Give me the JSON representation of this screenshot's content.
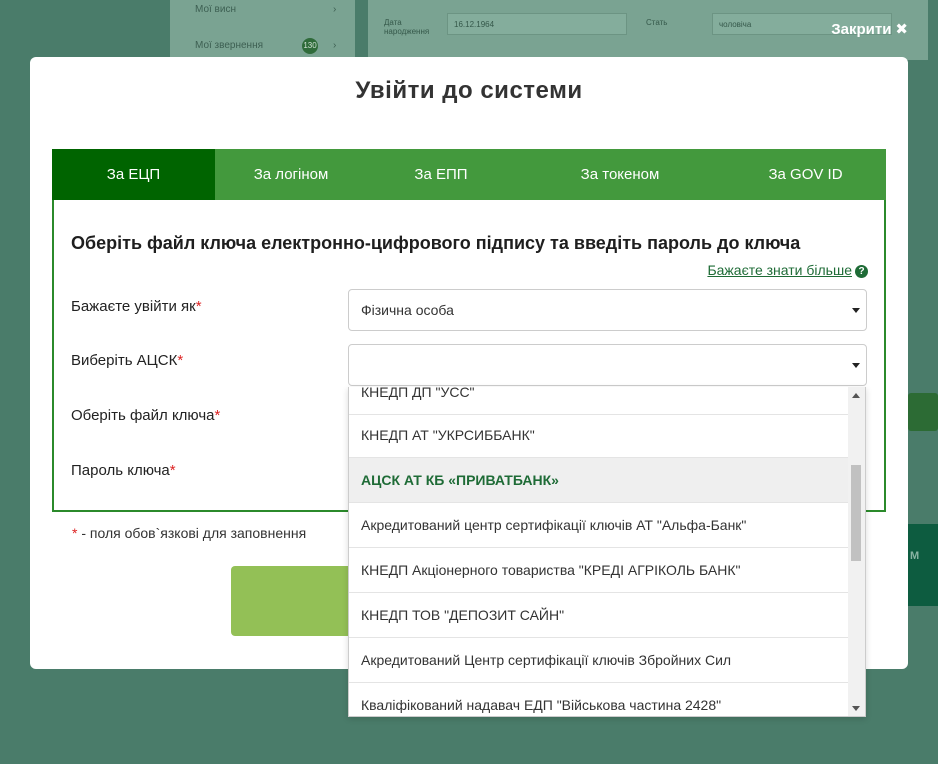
{
  "background": {
    "sidebar_items": [
      {
        "label": "Мої висн"
      },
      {
        "label": "Мої звернення",
        "badge": "130"
      }
    ],
    "form": {
      "dob_label": "Дата народження",
      "dob_value": "16.12.1964",
      "sex_label": "Стать",
      "sex_value": "чоловіча"
    },
    "side_block_label": "М"
  },
  "close": {
    "label": "Закрити"
  },
  "modal": {
    "title": "Увійти до системи",
    "tabs": [
      {
        "label": "За ЕЦП",
        "active": true
      },
      {
        "label": "За логіном"
      },
      {
        "label": "За ЕПП"
      },
      {
        "label": "За токеном"
      },
      {
        "label": "За GOV ID"
      }
    ],
    "heading": "Оберіть файл ключа електронно-цифрового підпису та введіть пароль до ключа",
    "more_link": "Бажаєте знати більше",
    "fields": {
      "login_as": {
        "label": "Бажаєте увійти як",
        "value": "Фізична особа"
      },
      "acsk": {
        "label": "Виберіть АЦСК",
        "value": ""
      },
      "key_file": {
        "label": "Оберіть файл ключа"
      },
      "key_password": {
        "label": "Пароль ключа"
      }
    },
    "required_marker": "*",
    "required_note": "- поля обов`язкові для заповнення"
  },
  "acsk_options": [
    {
      "label": "КНЕДП ДП \"УСС\""
    },
    {
      "label": "КНЕДП АТ \"УКРСИББАНК\""
    },
    {
      "label": "АЦСК АТ КБ «ПРИВАТБАНК»",
      "selected": true
    },
    {
      "label": "Акредитований центр сертифікації ключів АТ \"Альфа-Банк\""
    },
    {
      "label": "КНЕДП Акціонерного товариства \"КРЕДІ АГРІКОЛЬ БАНК\""
    },
    {
      "label": "КНЕДП ТОВ \"ДЕПОЗИТ САЙН\""
    },
    {
      "label": "Акредитований Центр сертифікації ключів Збройних Сил"
    },
    {
      "label": "Кваліфікований надавач ЕДП \"Військова частина 2428\""
    }
  ],
  "colors": {
    "overlay_bg": "#4a7c6a",
    "tab_bar": "#43993d",
    "tab_active": "#006400",
    "link": "#1e6b36",
    "required": "#dd2222",
    "submit": "#93c056"
  }
}
